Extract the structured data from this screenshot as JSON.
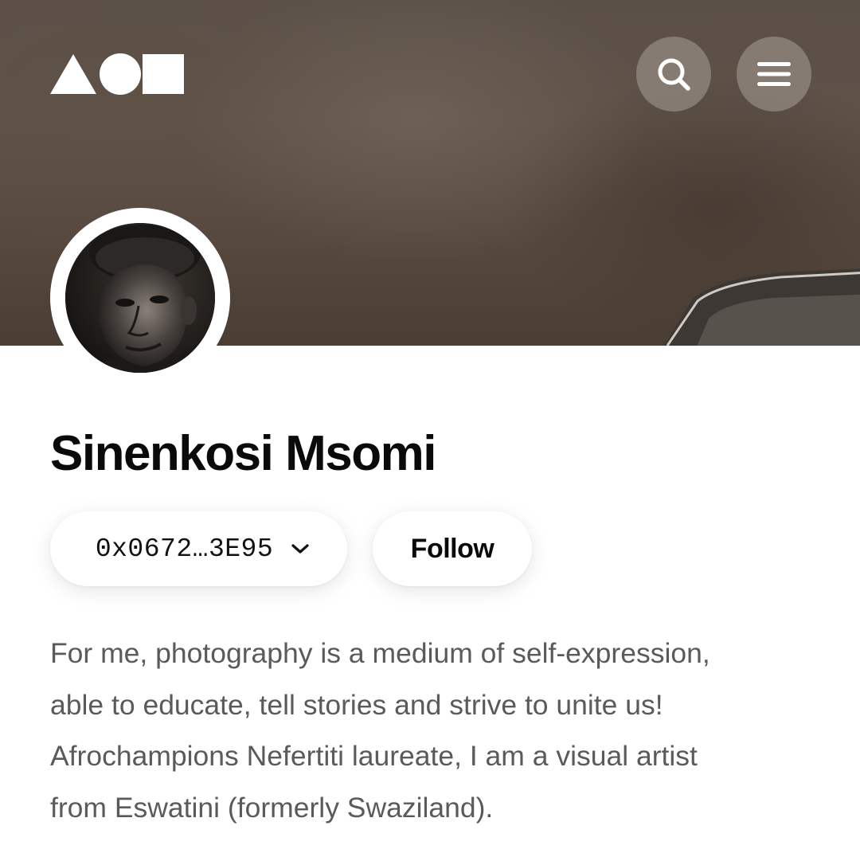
{
  "header": {
    "logo_icon": "shapes-logo-icon",
    "search_icon": "search-icon",
    "menu_icon": "hamburger-menu-icon"
  },
  "profile": {
    "name": "Sinenkosi Msomi",
    "wallet_address": "0x0672…3E95",
    "wallet_chevron_icon": "chevron-down-icon",
    "follow_label": "Follow",
    "bio_lines": [
      "For me, photography is a medium of self-expression,",
      "able to educate, tell stories and strive to unite us!",
      "Afrochampions Nefertiti laureate, I am a visual artist",
      "from Eswatini (formerly Swaziland)."
    ]
  },
  "colors": {
    "text_primary": "#0a0a0a",
    "text_secondary": "#5a5a5a",
    "button_overlay": "#968c84",
    "background": "#ffffff"
  }
}
